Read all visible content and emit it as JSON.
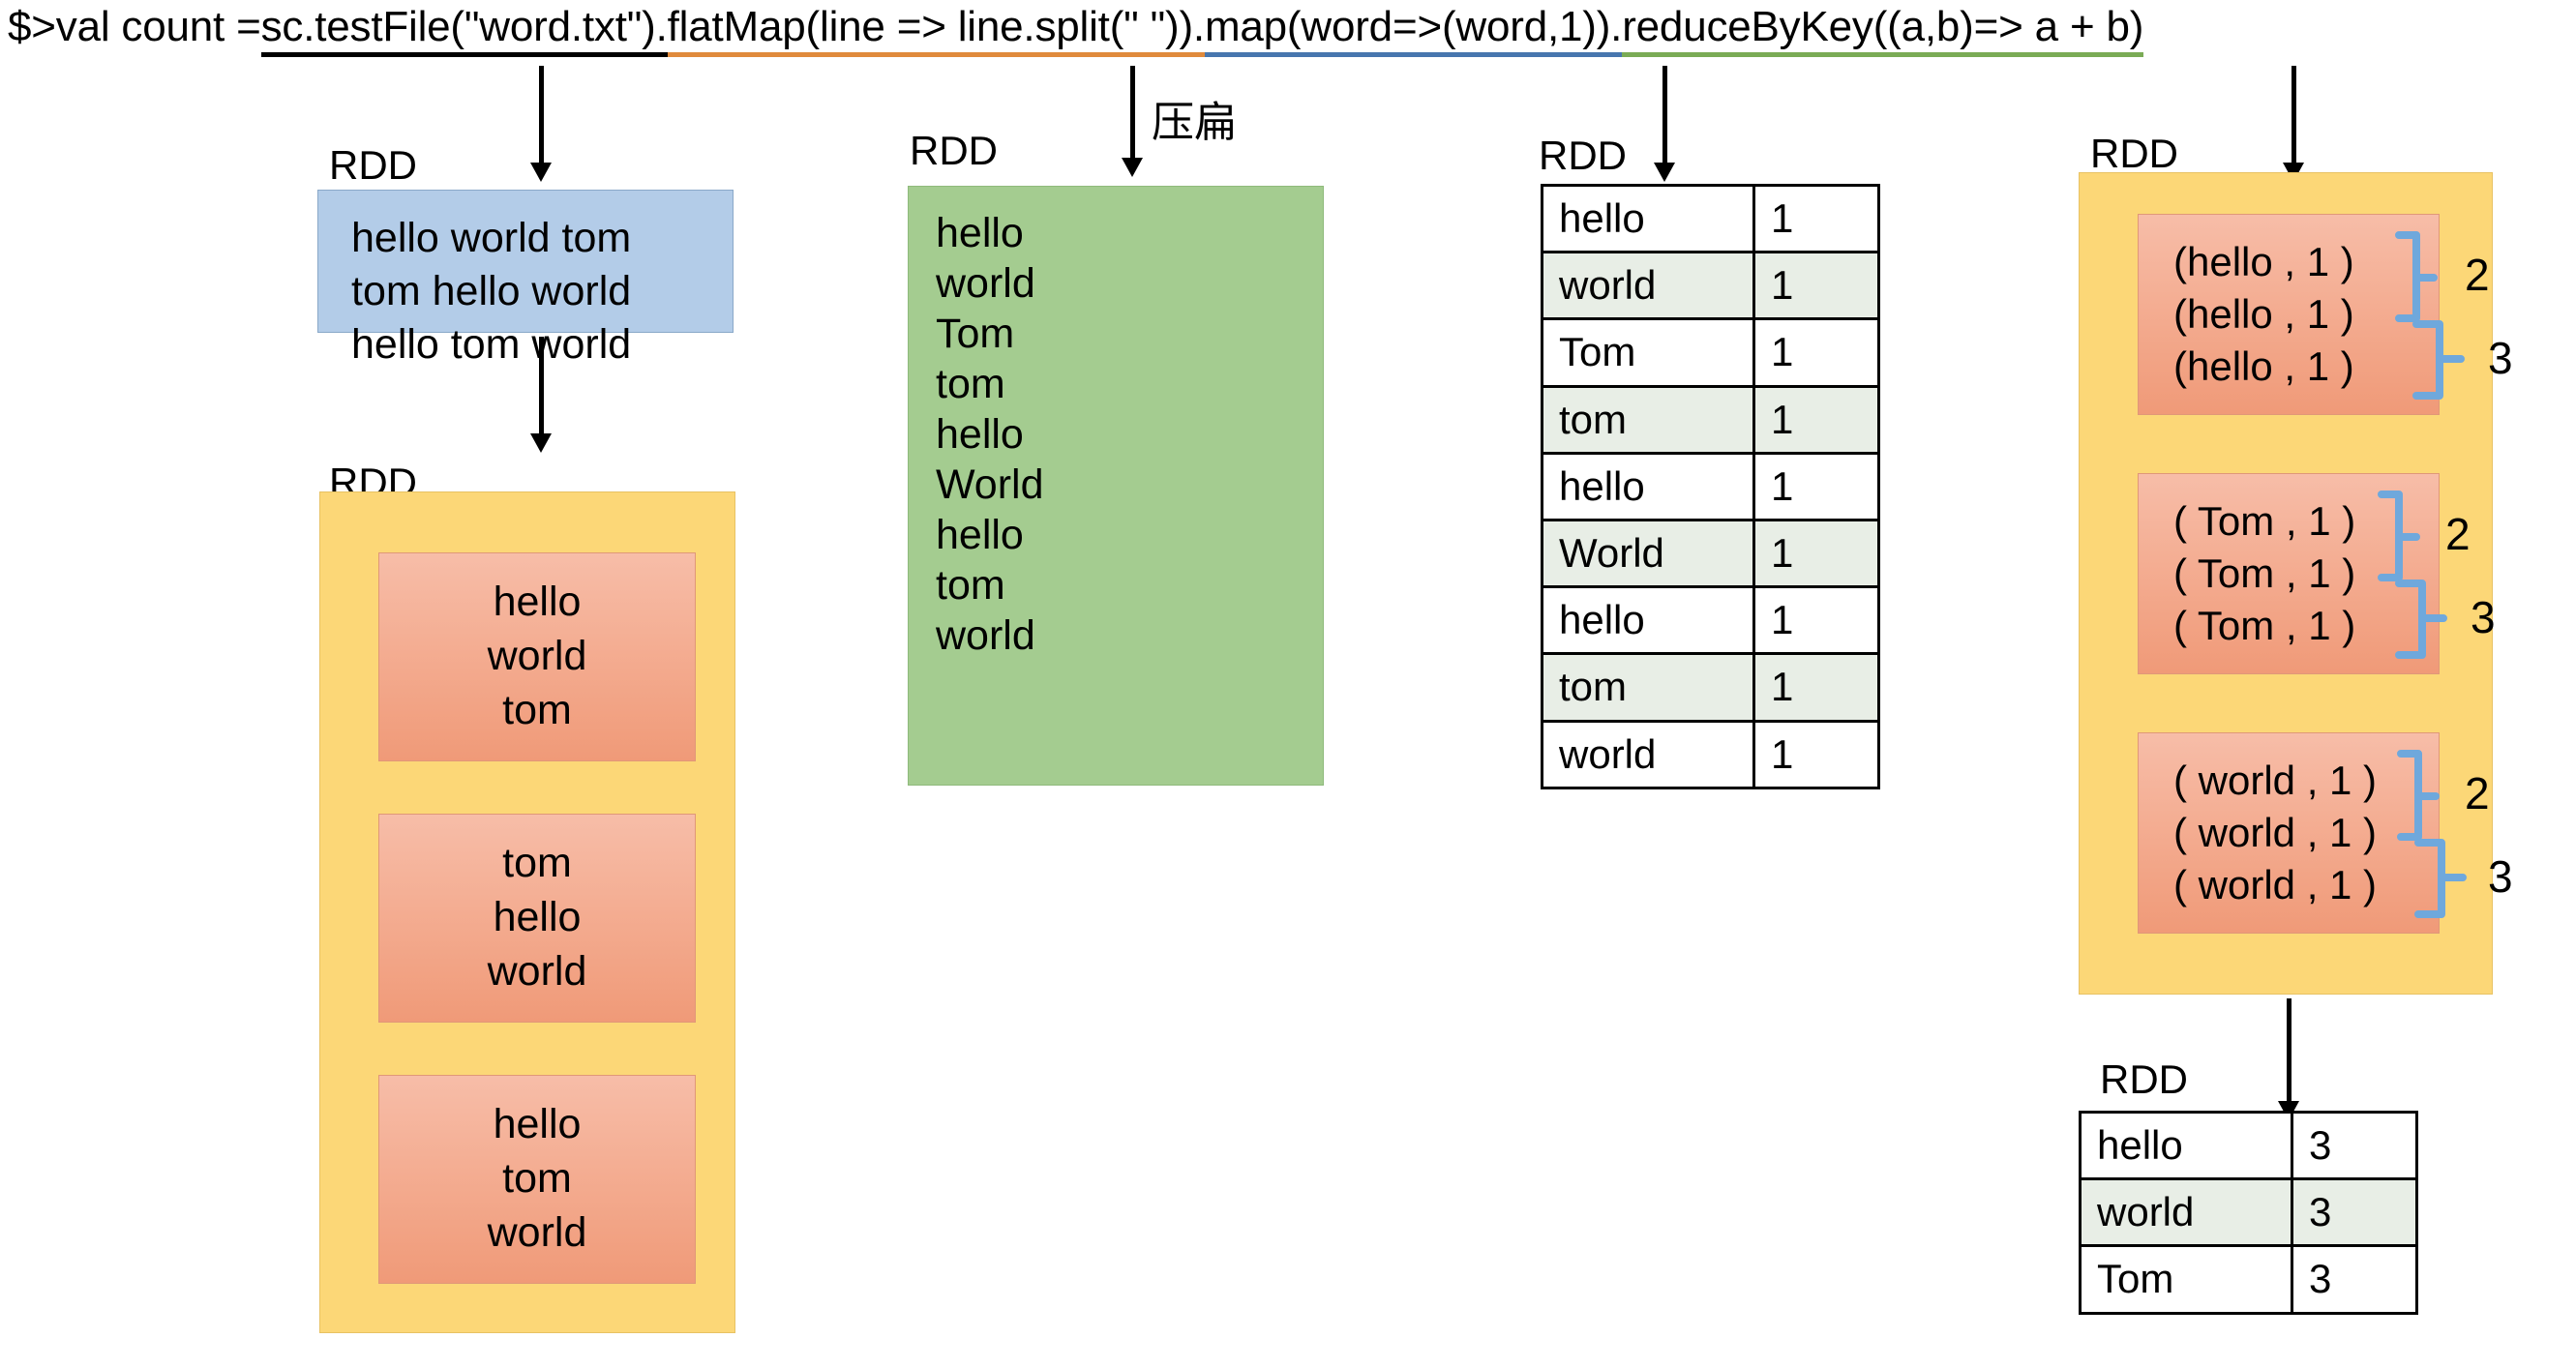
{
  "code": {
    "prefix": "$>val count = ",
    "segments": [
      {
        "text": "sc.testFile(\"word.txt\").",
        "underline": "#000000"
      },
      {
        "text": "flatMap(line => line.split(\" \")).",
        "underline": "#e08a3c"
      },
      {
        "text": "map(word=>(word,1)).",
        "underline": "#4776ae"
      },
      {
        "text": " reduceByKey((a,b)=> a + b)",
        "underline": "#7aab55"
      }
    ]
  },
  "labels": {
    "rdd": "RDD",
    "flatten_cn": "压扁"
  },
  "stage_textfile": {
    "label": "RDD",
    "lines": [
      "hello world tom",
      "tom hello world",
      "hello tom world"
    ]
  },
  "stage_partitions": {
    "label": "RDD",
    "partitions": [
      {
        "lines": [
          "hello",
          "world",
          "tom"
        ]
      },
      {
        "lines": [
          "tom",
          "hello",
          "world"
        ]
      },
      {
        "lines": [
          "hello",
          "tom",
          "world"
        ]
      }
    ]
  },
  "stage_flatmap": {
    "label": "RDD",
    "annotation": "压扁",
    "words": [
      "hello",
      "world",
      "Tom",
      "tom",
      "hello",
      "World",
      "hello",
      "tom",
      "world"
    ]
  },
  "stage_map": {
    "label": "RDD",
    "rows": [
      {
        "key": "hello",
        "value": "1"
      },
      {
        "key": "world",
        "value": "1"
      },
      {
        "key": "Tom",
        "value": "1"
      },
      {
        "key": " tom",
        "value": "1"
      },
      {
        "key": "hello",
        "value": "1"
      },
      {
        "key": "World",
        "value": "1"
      },
      {
        "key": "hello",
        "value": "1"
      },
      {
        "key": "tom",
        "value": "1"
      },
      {
        "key": "world",
        "value": "1"
      }
    ]
  },
  "stage_reduce": {
    "label": "RDD",
    "groups": [
      {
        "pairs": [
          "(hello , 1 )",
          "(hello , 1 )",
          "(hello , 1 )"
        ],
        "partial": "2",
        "total": "3"
      },
      {
        "pairs": [
          "( Tom , 1 )",
          "( Tom , 1 )",
          "( Tom , 1 )"
        ],
        "partial": "2",
        "total": "3"
      },
      {
        "pairs": [
          "( world , 1 )",
          "( world , 1 )",
          "( world , 1 )"
        ],
        "partial": "2",
        "total": "3"
      }
    ]
  },
  "stage_result": {
    "label": "RDD",
    "rows": [
      {
        "key": "hello",
        "value": "3"
      },
      {
        "key": "world",
        "value": "3"
      },
      {
        "key": "Tom",
        "value": "3"
      }
    ]
  },
  "colors": {
    "textfile_box": "#b3cce8",
    "partition_outer": "#fcd777",
    "partition_inner": "#f2a98e",
    "flatmap_box": "#a4cc90",
    "brace": "#6fa8dc",
    "underline_black": "#000000",
    "underline_orange": "#e08a3c",
    "underline_blue": "#4776ae",
    "underline_green": "#7aab55",
    "table_alt_row": "#e8eee6"
  }
}
